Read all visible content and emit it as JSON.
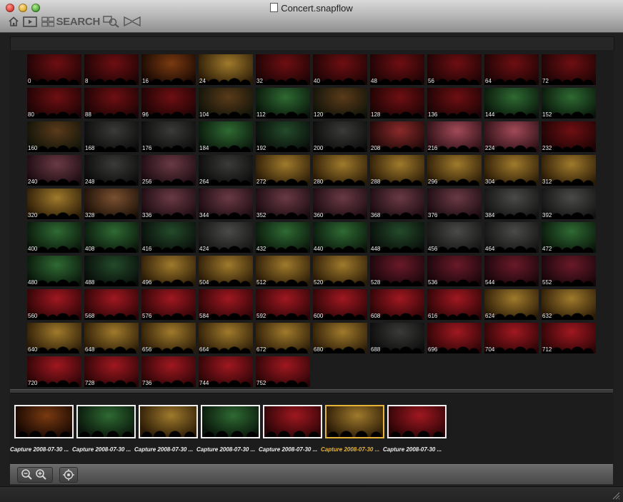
{
  "window": {
    "title": "Concert.snapflow"
  },
  "toolbar": {
    "home_icon": "home-icon",
    "play_icon": "play-slideshow-icon",
    "search_label": "SEARCH",
    "search_icon": "search-grid-icon",
    "magnifier_icon": "magnifier-icon",
    "compare_icon": "compare-icon"
  },
  "frames": [
    {
      "label": "0",
      "scene": "red"
    },
    {
      "label": "8",
      "scene": "red"
    },
    {
      "label": "16",
      "scene": "redgold"
    },
    {
      "label": "24",
      "scene": "gold"
    },
    {
      "label": "32",
      "scene": "red"
    },
    {
      "label": "40",
      "scene": "red"
    },
    {
      "label": "48",
      "scene": "red"
    },
    {
      "label": "56",
      "scene": "red"
    },
    {
      "label": "64",
      "scene": "red"
    },
    {
      "label": "72",
      "scene": "red"
    },
    {
      "label": "80",
      "scene": "red"
    },
    {
      "label": "88",
      "scene": "red"
    },
    {
      "label": "96",
      "scene": "red"
    },
    {
      "label": "104",
      "scene": "redgreen"
    },
    {
      "label": "112",
      "scene": "green"
    },
    {
      "label": "120",
      "scene": "redgreen"
    },
    {
      "label": "128",
      "scene": "red"
    },
    {
      "label": "136",
      "scene": "red"
    },
    {
      "label": "144",
      "scene": "green"
    },
    {
      "label": "152",
      "scene": "green"
    },
    {
      "label": "160",
      "scene": "redgreen"
    },
    {
      "label": "168",
      "scene": "dark"
    },
    {
      "label": "176",
      "scene": "dark"
    },
    {
      "label": "184",
      "scene": "green"
    },
    {
      "label": "192",
      "scene": "darkgreen"
    },
    {
      "label": "200",
      "scene": "dark"
    },
    {
      "label": "208",
      "scene": "redlight"
    },
    {
      "label": "216",
      "scene": "pink"
    },
    {
      "label": "224",
      "scene": "pink"
    },
    {
      "label": "232",
      "scene": "red"
    },
    {
      "label": "240",
      "scene": "mauve"
    },
    {
      "label": "248",
      "scene": "dark"
    },
    {
      "label": "256",
      "scene": "mauve"
    },
    {
      "label": "264",
      "scene": "dark"
    },
    {
      "label": "272",
      "scene": "gold"
    },
    {
      "label": "280",
      "scene": "gold"
    },
    {
      "label": "288",
      "scene": "gold"
    },
    {
      "label": "296",
      "scene": "gold"
    },
    {
      "label": "304",
      "scene": "gold"
    },
    {
      "label": "312",
      "scene": "gold"
    },
    {
      "label": "320",
      "scene": "gold"
    },
    {
      "label": "328",
      "scene": "brown"
    },
    {
      "label": "336",
      "scene": "mauve"
    },
    {
      "label": "344",
      "scene": "mauve"
    },
    {
      "label": "352",
      "scene": "mauve"
    },
    {
      "label": "360",
      "scene": "mauve"
    },
    {
      "label": "368",
      "scene": "mauve"
    },
    {
      "label": "376",
      "scene": "mauve"
    },
    {
      "label": "384",
      "scene": "grey"
    },
    {
      "label": "392",
      "scene": "grey"
    },
    {
      "label": "400",
      "scene": "green"
    },
    {
      "label": "408",
      "scene": "green"
    },
    {
      "label": "416",
      "scene": "darkgreen"
    },
    {
      "label": "424",
      "scene": "grey"
    },
    {
      "label": "432",
      "scene": "green"
    },
    {
      "label": "440",
      "scene": "green"
    },
    {
      "label": "448",
      "scene": "darkgreen"
    },
    {
      "label": "456",
      "scene": "grey"
    },
    {
      "label": "464",
      "scene": "grey"
    },
    {
      "label": "472",
      "scene": "green"
    },
    {
      "label": "480",
      "scene": "green"
    },
    {
      "label": "488",
      "scene": "darkgreen"
    },
    {
      "label": "496",
      "scene": "gold"
    },
    {
      "label": "504",
      "scene": "gold"
    },
    {
      "label": "512",
      "scene": "gold"
    },
    {
      "label": "520",
      "scene": "gold"
    },
    {
      "label": "528",
      "scene": "wine"
    },
    {
      "label": "536",
      "scene": "wine"
    },
    {
      "label": "544",
      "scene": "wine"
    },
    {
      "label": "552",
      "scene": "wine"
    },
    {
      "label": "560",
      "scene": "crimson"
    },
    {
      "label": "568",
      "scene": "crimson"
    },
    {
      "label": "576",
      "scene": "crimson"
    },
    {
      "label": "584",
      "scene": "crimson"
    },
    {
      "label": "592",
      "scene": "crimson"
    },
    {
      "label": "600",
      "scene": "crimson"
    },
    {
      "label": "608",
      "scene": "crimson"
    },
    {
      "label": "616",
      "scene": "crimson"
    },
    {
      "label": "624",
      "scene": "gold"
    },
    {
      "label": "632",
      "scene": "gold"
    },
    {
      "label": "640",
      "scene": "gold"
    },
    {
      "label": "648",
      "scene": "gold"
    },
    {
      "label": "656",
      "scene": "gold"
    },
    {
      "label": "664",
      "scene": "gold"
    },
    {
      "label": "672",
      "scene": "gold"
    },
    {
      "label": "680",
      "scene": "gold"
    },
    {
      "label": "688",
      "scene": "dark"
    },
    {
      "label": "696",
      "scene": "crimson"
    },
    {
      "label": "704",
      "scene": "crimson"
    },
    {
      "label": "712",
      "scene": "crimson"
    },
    {
      "label": "720",
      "scene": "crimson"
    },
    {
      "label": "728",
      "scene": "crimson"
    },
    {
      "label": "736",
      "scene": "crimson"
    },
    {
      "label": "744",
      "scene": "crimson"
    },
    {
      "label": "752",
      "scene": "crimson"
    }
  ],
  "captures": [
    {
      "name": "Capture 2008-07-30 ...",
      "scene": "redgold",
      "selected": false
    },
    {
      "name": "Capture 2008-07-30 ...",
      "scene": "green",
      "selected": false
    },
    {
      "name": "Capture 2008-07-30 ...",
      "scene": "gold",
      "selected": false
    },
    {
      "name": "Capture 2008-07-30 ...",
      "scene": "green",
      "selected": false
    },
    {
      "name": "Capture 2008-07-30 ...",
      "scene": "crimson",
      "selected": false
    },
    {
      "name": "Capture 2008-07-30 ...",
      "scene": "gold",
      "selected": true
    },
    {
      "name": "Capture 2008-07-30 ...",
      "scene": "crimson",
      "selected": false
    }
  ],
  "bottom_toolbar": {
    "zoom_out_icon": "zoom-out-icon",
    "zoom_in_icon": "zoom-in-icon",
    "locate_icon": "locate-icon"
  },
  "colors": {
    "selected_accent": "#e6b43a",
    "scenes": {
      "red": [
        "#6e0f12",
        "#1a0304"
      ],
      "redgold": [
        "#7a3a10",
        "#140602"
      ],
      "gold": [
        "#a07a2c",
        "#2a1a06"
      ],
      "redgreen": [
        "#5a3a1a",
        "#0f1208"
      ],
      "green": [
        "#2f6a32",
        "#08140a"
      ],
      "dark": [
        "#3a3a38",
        "#0a0a0a"
      ],
      "darkgreen": [
        "#234a2a",
        "#070b08"
      ],
      "redlight": [
        "#8a2a2a",
        "#1a0606"
      ],
      "pink": [
        "#a24a58",
        "#2a0e14"
      ],
      "mauve": [
        "#6a3a44",
        "#1a0a10"
      ],
      "brown": [
        "#7a5030",
        "#1a0e06"
      ],
      "grey": [
        "#4a4a48",
        "#121212"
      ],
      "wine": [
        "#6a1a28",
        "#16050a"
      ],
      "crimson": [
        "#a01820",
        "#2a0406"
      ]
    }
  }
}
